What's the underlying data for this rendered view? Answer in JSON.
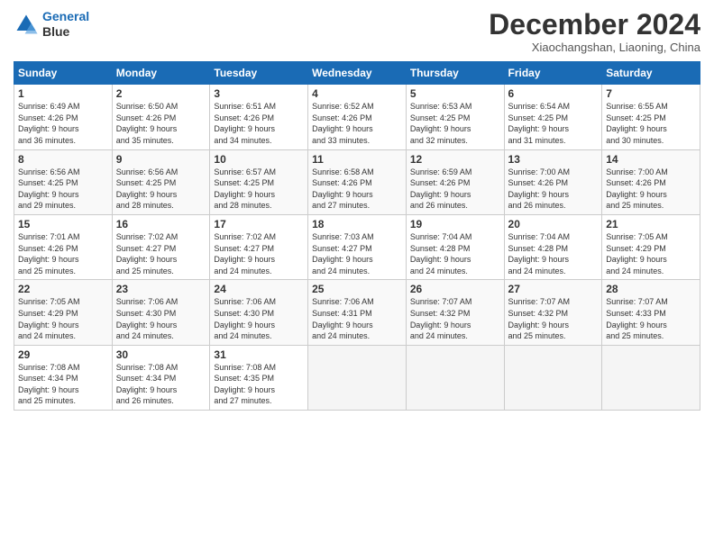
{
  "logo": {
    "line1": "General",
    "line2": "Blue"
  },
  "title": "December 2024",
  "subtitle": "Xiaochangshan, Liaoning, China",
  "days_header": [
    "Sunday",
    "Monday",
    "Tuesday",
    "Wednesday",
    "Thursday",
    "Friday",
    "Saturday"
  ],
  "weeks": [
    [
      {
        "day": "1",
        "info": "Sunrise: 6:49 AM\nSunset: 4:26 PM\nDaylight: 9 hours\nand 36 minutes."
      },
      {
        "day": "2",
        "info": "Sunrise: 6:50 AM\nSunset: 4:26 PM\nDaylight: 9 hours\nand 35 minutes."
      },
      {
        "day": "3",
        "info": "Sunrise: 6:51 AM\nSunset: 4:26 PM\nDaylight: 9 hours\nand 34 minutes."
      },
      {
        "day": "4",
        "info": "Sunrise: 6:52 AM\nSunset: 4:26 PM\nDaylight: 9 hours\nand 33 minutes."
      },
      {
        "day": "5",
        "info": "Sunrise: 6:53 AM\nSunset: 4:25 PM\nDaylight: 9 hours\nand 32 minutes."
      },
      {
        "day": "6",
        "info": "Sunrise: 6:54 AM\nSunset: 4:25 PM\nDaylight: 9 hours\nand 31 minutes."
      },
      {
        "day": "7",
        "info": "Sunrise: 6:55 AM\nSunset: 4:25 PM\nDaylight: 9 hours\nand 30 minutes."
      }
    ],
    [
      {
        "day": "8",
        "info": "Sunrise: 6:56 AM\nSunset: 4:25 PM\nDaylight: 9 hours\nand 29 minutes."
      },
      {
        "day": "9",
        "info": "Sunrise: 6:56 AM\nSunset: 4:25 PM\nDaylight: 9 hours\nand 28 minutes."
      },
      {
        "day": "10",
        "info": "Sunrise: 6:57 AM\nSunset: 4:25 PM\nDaylight: 9 hours\nand 28 minutes."
      },
      {
        "day": "11",
        "info": "Sunrise: 6:58 AM\nSunset: 4:26 PM\nDaylight: 9 hours\nand 27 minutes."
      },
      {
        "day": "12",
        "info": "Sunrise: 6:59 AM\nSunset: 4:26 PM\nDaylight: 9 hours\nand 26 minutes."
      },
      {
        "day": "13",
        "info": "Sunrise: 7:00 AM\nSunset: 4:26 PM\nDaylight: 9 hours\nand 26 minutes."
      },
      {
        "day": "14",
        "info": "Sunrise: 7:00 AM\nSunset: 4:26 PM\nDaylight: 9 hours\nand 25 minutes."
      }
    ],
    [
      {
        "day": "15",
        "info": "Sunrise: 7:01 AM\nSunset: 4:26 PM\nDaylight: 9 hours\nand 25 minutes."
      },
      {
        "day": "16",
        "info": "Sunrise: 7:02 AM\nSunset: 4:27 PM\nDaylight: 9 hours\nand 25 minutes."
      },
      {
        "day": "17",
        "info": "Sunrise: 7:02 AM\nSunset: 4:27 PM\nDaylight: 9 hours\nand 24 minutes."
      },
      {
        "day": "18",
        "info": "Sunrise: 7:03 AM\nSunset: 4:27 PM\nDaylight: 9 hours\nand 24 minutes."
      },
      {
        "day": "19",
        "info": "Sunrise: 7:04 AM\nSunset: 4:28 PM\nDaylight: 9 hours\nand 24 minutes."
      },
      {
        "day": "20",
        "info": "Sunrise: 7:04 AM\nSunset: 4:28 PM\nDaylight: 9 hours\nand 24 minutes."
      },
      {
        "day": "21",
        "info": "Sunrise: 7:05 AM\nSunset: 4:29 PM\nDaylight: 9 hours\nand 24 minutes."
      }
    ],
    [
      {
        "day": "22",
        "info": "Sunrise: 7:05 AM\nSunset: 4:29 PM\nDaylight: 9 hours\nand 24 minutes."
      },
      {
        "day": "23",
        "info": "Sunrise: 7:06 AM\nSunset: 4:30 PM\nDaylight: 9 hours\nand 24 minutes."
      },
      {
        "day": "24",
        "info": "Sunrise: 7:06 AM\nSunset: 4:30 PM\nDaylight: 9 hours\nand 24 minutes."
      },
      {
        "day": "25",
        "info": "Sunrise: 7:06 AM\nSunset: 4:31 PM\nDaylight: 9 hours\nand 24 minutes."
      },
      {
        "day": "26",
        "info": "Sunrise: 7:07 AM\nSunset: 4:32 PM\nDaylight: 9 hours\nand 24 minutes."
      },
      {
        "day": "27",
        "info": "Sunrise: 7:07 AM\nSunset: 4:32 PM\nDaylight: 9 hours\nand 25 minutes."
      },
      {
        "day": "28",
        "info": "Sunrise: 7:07 AM\nSunset: 4:33 PM\nDaylight: 9 hours\nand 25 minutes."
      }
    ],
    [
      {
        "day": "29",
        "info": "Sunrise: 7:08 AM\nSunset: 4:34 PM\nDaylight: 9 hours\nand 25 minutes."
      },
      {
        "day": "30",
        "info": "Sunrise: 7:08 AM\nSunset: 4:34 PM\nDaylight: 9 hours\nand 26 minutes."
      },
      {
        "day": "31",
        "info": "Sunrise: 7:08 AM\nSunset: 4:35 PM\nDaylight: 9 hours\nand 27 minutes."
      },
      null,
      null,
      null,
      null
    ]
  ]
}
